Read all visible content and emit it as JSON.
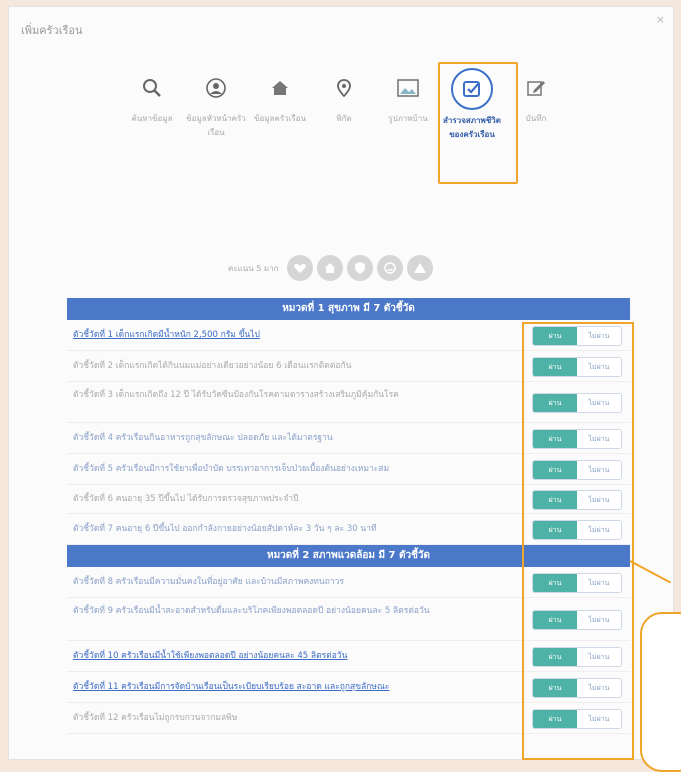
{
  "window": {
    "title": "เพิ่มครัวเรือน",
    "close": "×"
  },
  "steps": [
    {
      "icon": "search-icon",
      "label": "ค้นหาข้อมูล",
      "active": false
    },
    {
      "icon": "user-icon",
      "label": "ข้อมูลหัวหน้าครัวเรือน",
      "active": false
    },
    {
      "icon": "home-icon",
      "label": "ข้อมูลครัวเรือน",
      "active": false
    },
    {
      "icon": "location-icon",
      "label": "พิกัด",
      "active": false
    },
    {
      "icon": "image-icon",
      "label": "รูปภาพบ้าน",
      "active": false
    },
    {
      "icon": "checkbox-icon",
      "label": "สำรวจสภาพชีวิตของครัวเรือน",
      "active": true
    },
    {
      "icon": "edit-icon",
      "label": "บันทึก",
      "active": false
    }
  ],
  "rating": {
    "label": "คะแนน 5 มาก"
  },
  "categories": [
    {
      "title": "หมวดที่ 1 สุขภาพ มี 7 ตัวชี้วัด",
      "items": [
        {
          "text": "ตัวชี้วัดที่ 1 เด็กแรกเกิดมีน้ำหนัก 2,500 กรัม ขึ้นไป",
          "style": "link"
        },
        {
          "text": "ตัวชี้วัดที่ 2 เด็กแรกเกิดได้กินนมแม่อย่างเดียวอย่างน้อย 6 เดือนแรกติดต่อกัน",
          "style": "gray"
        },
        {
          "text": "ตัวชี้วัดที่ 3 เด็กแรกเกิดถึง 12 ปี ได้รับวัคซีนป้องกันโรคตามตารางสร้างเสริมภูมิคุ้มกันโรค",
          "style": "gray"
        },
        {
          "text": "ตัวชี้วัดที่ 4 ครัวเรือนกินอาหารถูกสุขลักษณะ ปลอดภัย และได้มาตรฐาน",
          "style": "normal"
        },
        {
          "text": "ตัวชี้วัดที่ 5 ครัวเรือนมีการใช้ยาเพื่อบำบัด บรรเทาอาการเจ็บป่วยเบื้องต้นอย่างเหมาะสม",
          "style": "normal"
        },
        {
          "text": "ตัวชี้วัดที่ 6 คนอายุ 35 ปีขึ้นไป ได้รับการตรวจสุขภาพประจำปี",
          "style": "gray"
        },
        {
          "text": "ตัวชี้วัดที่ 7 คนอายุ 6 ปีขึ้นไป ออกกำลังกายอย่างน้อยสัปดาห์ละ 3 วัน ๆ ละ 30 นาที",
          "style": "normal"
        }
      ]
    },
    {
      "title": "หมวดที่ 2 สภาพแวดล้อม มี 7 ตัวชี้วัด",
      "items": [
        {
          "text": "ตัวชี้วัดที่ 8 ครัวเรือนมีความมั่นคงในที่อยู่อาศัย และบ้านมีสภาพคงทนถาวร",
          "style": "normal"
        },
        {
          "text": "ตัวชี้วัดที่ 9 ครัวเรือนมีน้ำสะอาดสำหรับดื่มและบริโภคเพียงพอตลอดปี อย่างน้อยคนละ 5 ลิตรต่อวัน",
          "style": "normal"
        },
        {
          "text": "ตัวชี้วัดที่ 10 ครัวเรือนมีน้ำใช้เพียงพอตลอดปี อย่างน้อยคนละ 45 ลิตรต่อวัน",
          "style": "link"
        },
        {
          "text": "ตัวชี้วัดที่ 11 ครัวเรือนมีการจัดบ้านเรือนเป็นระเบียบเรียบร้อย สะอาด และถูกสุขลักษณะ",
          "style": "link"
        },
        {
          "text": "ตัวชี้วัดที่ 12 ครัวเรือนไม่ถูกรบกวนจากมลพิษ",
          "style": "gray"
        }
      ]
    }
  ],
  "toggle": {
    "yes": "ผ่าน",
    "no": "ไม่ผ่าน"
  },
  "colors": {
    "header": "#4b78c8",
    "yes": "#4eb2a6",
    "highlight": "#f0a42a"
  }
}
